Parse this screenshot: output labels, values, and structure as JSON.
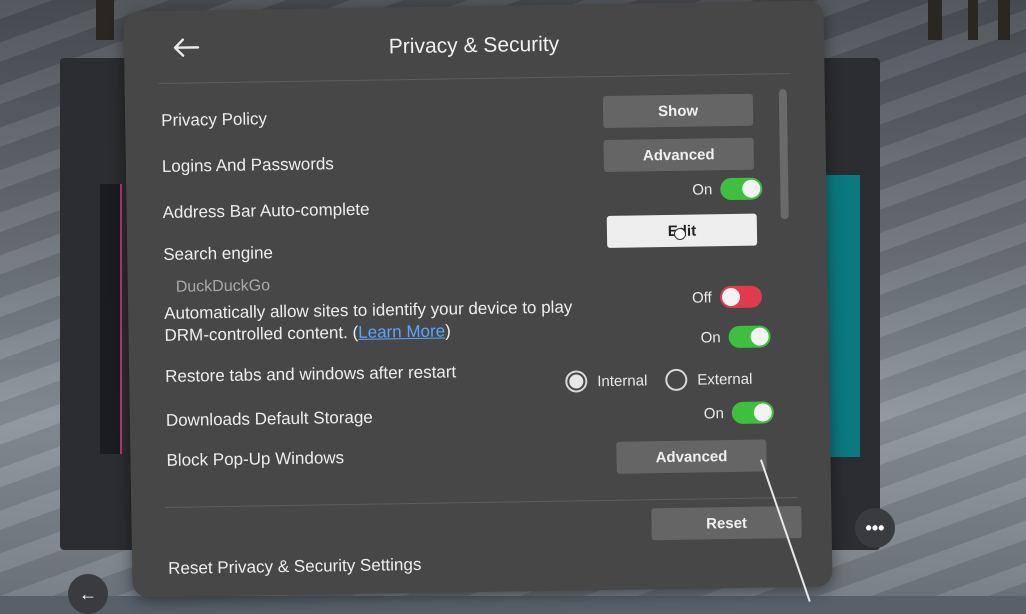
{
  "header": {
    "title": "Privacy & Security"
  },
  "settings": {
    "privacy_policy": {
      "label": "Privacy Policy",
      "button": "Show"
    },
    "logins": {
      "label": "Logins And Passwords",
      "button": "Advanced"
    },
    "address_bar": {
      "label": "Address Bar Auto-complete",
      "state": "On"
    },
    "search_engine": {
      "label": "Search engine",
      "button": "Edit",
      "value": "DuckDuckGo"
    },
    "drm": {
      "label_line1": "Automatically allow sites to identify your device to play",
      "label_line2_prefix": "DRM-controlled content. (",
      "link": "Learn More",
      "label_line2_suffix": ")",
      "state": "Off"
    },
    "restore_tabs": {
      "label": "Restore tabs and windows after restart",
      "state": "On"
    },
    "downloads": {
      "label": "Downloads Default Storage",
      "options": [
        "Internal",
        "External"
      ],
      "selected": "Internal"
    },
    "popups": {
      "label": "Block Pop-Up Windows",
      "state": "On",
      "button": "Advanced"
    },
    "reset": {
      "label": "Reset Privacy & Security Settings",
      "button": "Reset"
    }
  },
  "colors": {
    "toggle_on": "#3fbf3f",
    "toggle_off": "#e03a4e",
    "link": "#58a6ff"
  },
  "icons": {
    "back": "arrow-left-icon",
    "more": "more-horizontal-icon"
  }
}
